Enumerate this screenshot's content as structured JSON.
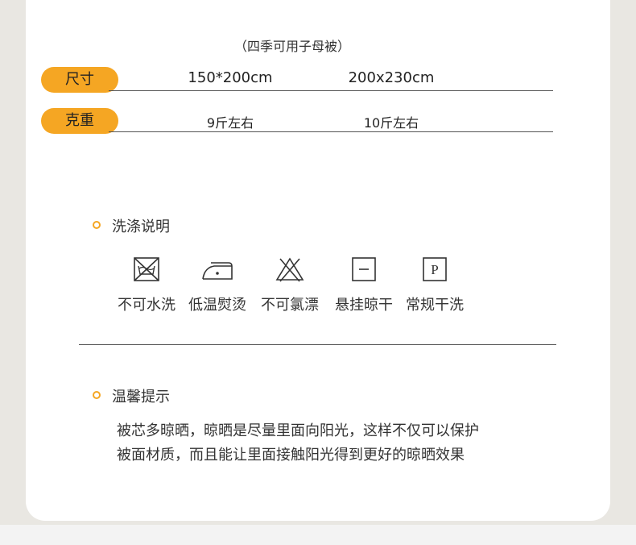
{
  "subtitle": "（四季可用子母被）",
  "specs": [
    {
      "label": "尺寸",
      "values": [
        "150*200cm",
        "200x230cm"
      ]
    },
    {
      "label": "克重",
      "values": [
        "9斤左右",
        "10斤左右"
      ]
    }
  ],
  "care": {
    "title": "洗涤说明",
    "items": [
      {
        "label": "不可水洗",
        "icon": "no-machine-wash-icon"
      },
      {
        "label": "低温熨烫",
        "icon": "low-iron-icon"
      },
      {
        "label": "不可氯漂",
        "icon": "no-bleach-icon"
      },
      {
        "label": "悬挂晾干",
        "icon": "line-dry-icon"
      },
      {
        "label": "常规干洗",
        "icon": "dry-clean-icon"
      }
    ],
    "dry_clean_letter": "P"
  },
  "tips": {
    "title": "温馨提示",
    "lines": [
      "被芯多晾晒，晾晒是尽量里面向阳光，这样不仅可以保护",
      "被面材质，而且能让里面接触阳光得到更好的晾晒效果"
    ]
  },
  "colors": {
    "accent": "#f5a623"
  }
}
